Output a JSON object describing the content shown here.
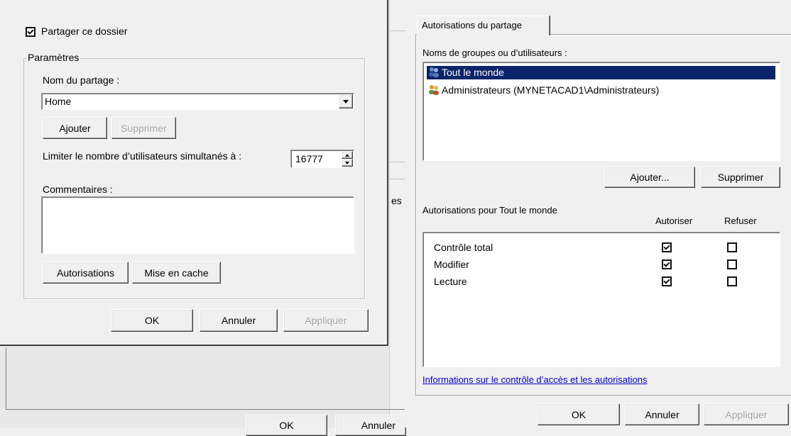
{
  "left_dialog": {
    "share_checkbox": {
      "label": "Partager ce dossier",
      "checked": true
    },
    "settings_group": "Paramètres",
    "share_name_label": "Nom du partage :",
    "share_name_value": "Home",
    "add_button": "Ajouter",
    "remove_button": "Supprimer",
    "limit_label": "Limiter le nombre d’utilisateurs simultanés à :",
    "limit_value": "16777",
    "comments_label": "Commentaires :",
    "comments_value": "",
    "permissions_button": "Autorisations",
    "caching_button": "Mise en cache",
    "ok_button": "OK",
    "cancel_button": "Annuler",
    "apply_button": "Appliquer"
  },
  "background_window": {
    "fragment_text": "es",
    "ok_button": "OK",
    "cancel_button": "Annuler"
  },
  "right_dialog": {
    "tab": "Autorisations du partage",
    "groups_label": "Noms de groupes ou d’utilisateurs :",
    "users": [
      {
        "name": "Tout le monde",
        "selected": true
      },
      {
        "name": "Administrateurs (MYNETACAD1\\Administrateurs)",
        "selected": false
      }
    ],
    "add_button": "Ajouter...",
    "remove_button": "Supprimer",
    "permissions_for_label": "Autorisations pour Tout le monde",
    "col_allow": "Autoriser",
    "col_deny": "Refuser",
    "permissions": [
      {
        "name": "Contrôle total",
        "allow": true,
        "deny": false
      },
      {
        "name": "Modifier",
        "allow": true,
        "deny": false
      },
      {
        "name": "Lecture",
        "allow": true,
        "deny": false
      }
    ],
    "info_link": "Informations sur le contrôle d’accès et les autorisations",
    "ok_button": "OK",
    "cancel_button": "Annuler",
    "apply_button": "Appliquer"
  },
  "colors": {
    "selection": "#0a246a",
    "link": "#0000cc",
    "dialog_bg": "#f0f0f0"
  }
}
